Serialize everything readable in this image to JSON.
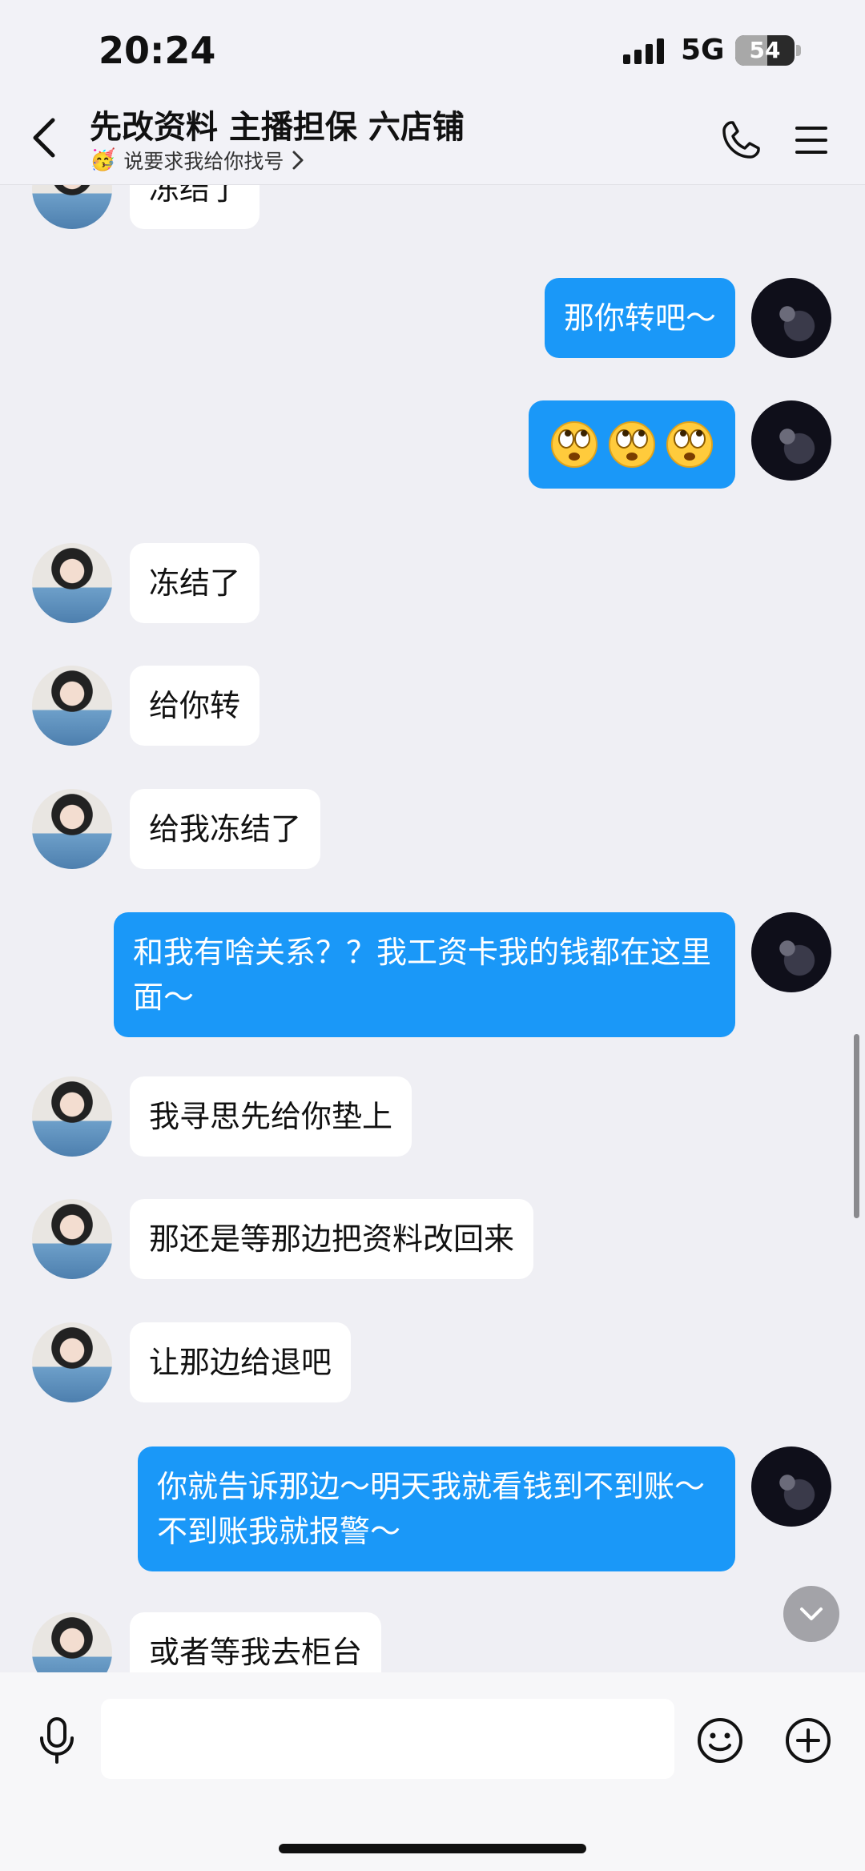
{
  "status": {
    "time": "20:24",
    "network": "5G",
    "battery": "54",
    "battery_level": 0.54
  },
  "header": {
    "title": "先改资料 主播担保 六店铺",
    "subtitle_emoji": "🥳",
    "subtitle": "说要求我给你找号"
  },
  "messages": [
    {
      "side": "in",
      "text": "冻结了"
    },
    {
      "side": "out",
      "text": "那你转吧～"
    },
    {
      "side": "out",
      "type": "emoji",
      "emoji": [
        "eye-roll-emoji",
        "eye-roll-emoji",
        "eye-roll-emoji"
      ]
    },
    {
      "side": "in",
      "text": "冻结了"
    },
    {
      "side": "in",
      "text": "给你转"
    },
    {
      "side": "in",
      "text": "给我冻结了"
    },
    {
      "side": "out",
      "text": "和我有啥关系？？我工资卡我的钱都在这里面～"
    },
    {
      "side": "in",
      "text": "我寻思先给你垫上"
    },
    {
      "side": "in",
      "text": "那还是等那边把资料改回来"
    },
    {
      "side": "in",
      "text": "让那边给退吧"
    },
    {
      "side": "out",
      "text": "你就告诉那边～明天我就看钱到不到账～不到账我就报警～"
    },
    {
      "side": "in",
      "text": "或者等我去柜台"
    }
  ],
  "input": {
    "value": "",
    "placeholder": ""
  },
  "icons": {
    "back": "back-chevron-icon",
    "call": "phone-icon",
    "menu": "menu-icon",
    "mic": "microphone-icon",
    "emoji": "smiley-icon",
    "plus": "plus-circle-icon",
    "jump": "chevron-down-icon"
  },
  "colors": {
    "outgoing_bubble": "#1a98f8",
    "incoming_bubble": "#ffffff",
    "background": "#efeff4"
  }
}
